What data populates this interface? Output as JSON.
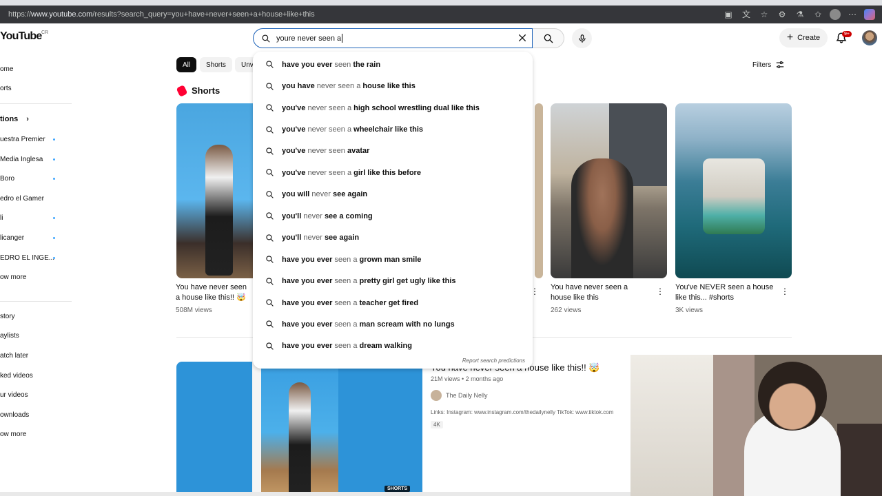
{
  "browser": {
    "url_prefix": "https://",
    "url_domain": "www.youtube.com",
    "url_path": "/results?search_query=you+have+never+seen+a+house+like+this"
  },
  "header": {
    "logo_text": "YouTube",
    "country_code": "CR",
    "search_query": "youre never seen a",
    "create_label": "Create",
    "notification_count": "9+"
  },
  "sidebar": {
    "top_items": [
      {
        "label": "ome"
      },
      {
        "label": "orts"
      }
    ],
    "subscriptions_heading": "tions",
    "subscriptions": [
      {
        "label": "uestra Premier",
        "dot": true
      },
      {
        "label": " Media Inglesa",
        "dot": true
      },
      {
        "label": "Boro",
        "dot": true
      },
      {
        "label": "edro el Gamer",
        "dot": false
      },
      {
        "label": "li",
        "dot": true
      },
      {
        "label": "licanger",
        "dot": true
      },
      {
        "label": "EDRO EL INGE...",
        "dot": true
      },
      {
        "label": "ow more",
        "dot": false
      }
    ],
    "you_items": [
      {
        "label": "story"
      },
      {
        "label": "aylists"
      },
      {
        "label": "atch later"
      },
      {
        "label": "ked videos"
      },
      {
        "label": "ur videos"
      },
      {
        "label": "ownloads"
      },
      {
        "label": "ow more"
      }
    ]
  },
  "chips": [
    {
      "label": "All",
      "active": true
    },
    {
      "label": "Shorts",
      "active": false
    },
    {
      "label": "Unv",
      "active": false
    }
  ],
  "filters_label": "Filters",
  "shorts": {
    "heading": "Shorts",
    "items": [
      {
        "title": "You have never seen a house like this!! 🤯",
        "views": "508M views"
      },
      {
        "title": "You have never seen a house like this",
        "views": "262 views"
      },
      {
        "title": "You've NEVER seen a house like this... #shorts",
        "views": "3K views"
      }
    ]
  },
  "video": {
    "title": "You have never seen a house like this!! 🤯",
    "meta": "21M views • 2 months ago",
    "channel": "The Daily Nelly",
    "description": "Links: Instagram: www.instagram.com/thedailynelly TikTok: www.tiktok.com",
    "badge": "4K",
    "shorts_tag": "SHORTS"
  },
  "suggestions": [
    {
      "typed": "",
      "rest": "have you ever",
      "typed2": " seen ",
      "rest2": "the rain"
    },
    {
      "typed": "",
      "rest": "you have",
      "typed2": " never seen a ",
      "rest2": "house like this"
    },
    {
      "typed": "",
      "rest": "you've",
      "typed2": " never seen a ",
      "rest2": "high school wrestling dual like this"
    },
    {
      "typed": "",
      "rest": "you've",
      "typed2": " never seen a ",
      "rest2": "wheelchair like this"
    },
    {
      "typed": "",
      "rest": "you've",
      "typed2": " never seen ",
      "rest2": "avatar"
    },
    {
      "typed": "",
      "rest": "you've",
      "typed2": " never seen a ",
      "rest2": "girl like this before"
    },
    {
      "typed": "",
      "rest": "you will",
      "typed2": " never ",
      "rest2": "see again"
    },
    {
      "typed": "",
      "rest": "you'll",
      "typed2": " never ",
      "rest2": "see a coming"
    },
    {
      "typed": "",
      "rest": "you'll",
      "typed2": " never ",
      "rest2": "see again"
    },
    {
      "typed": "",
      "rest": "have you ever",
      "typed2": " seen a ",
      "rest2": "grown man smile"
    },
    {
      "typed": "",
      "rest": "have you ever",
      "typed2": " seen a ",
      "rest2": "pretty girl get ugly like this"
    },
    {
      "typed": "",
      "rest": "have you ever",
      "typed2": " seen a ",
      "rest2": "teacher get fired"
    },
    {
      "typed": "",
      "rest": "have you ever",
      "typed2": " seen a ",
      "rest2": "man scream with no lungs"
    },
    {
      "typed": "",
      "rest": "have you ever",
      "typed2": " seen a ",
      "rest2": "dream walking"
    }
  ],
  "report_label": "Report search predictions",
  "colors": {
    "accent_red": "#ff0033",
    "search_border": "#1c62b9",
    "chip_active": "#0f0f0f",
    "sub_dot": "#3ea6ff"
  }
}
